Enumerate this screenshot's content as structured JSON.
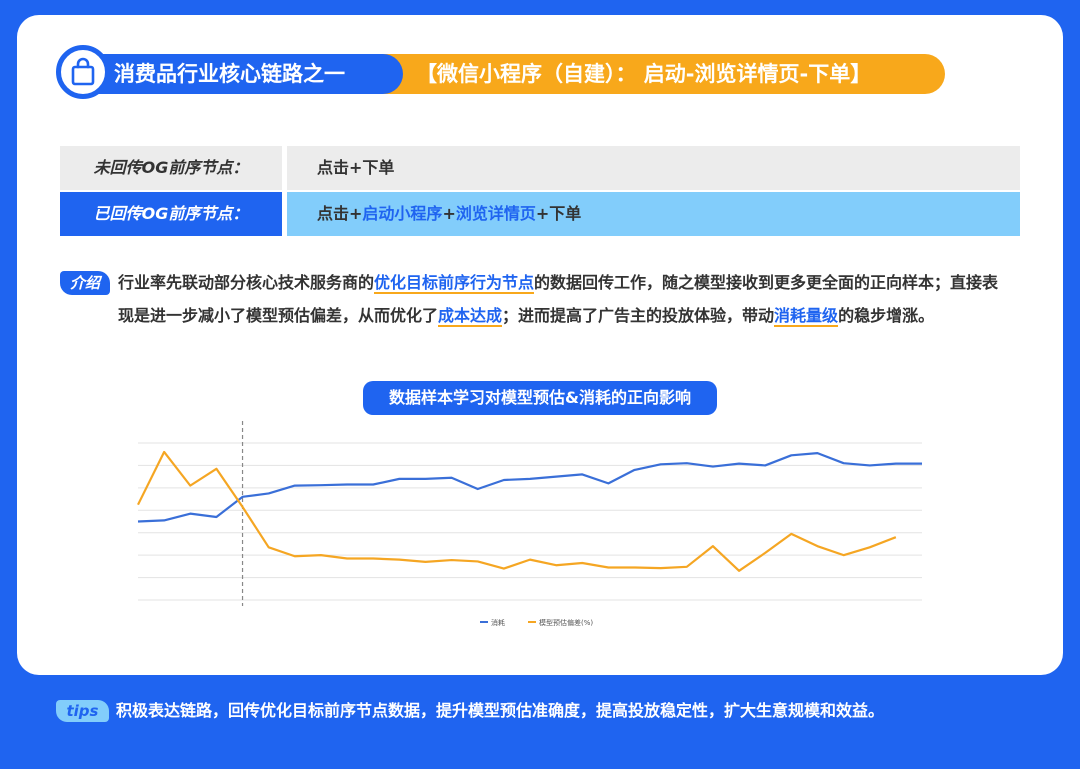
{
  "header": {
    "title": "消费品行业核心链路之一",
    "subtitle": "【微信小程序（自建）： 启动-浏览详情页-下单】",
    "icon": "shopping-bag-icon"
  },
  "table": {
    "row1": {
      "label": "未回传OG前序节点：",
      "value": "点击+下单"
    },
    "row2": {
      "label": "已回传OG前序节点：",
      "segments": [
        "点击+",
        "启动小程序",
        "+",
        "浏览详情页",
        "+下单"
      ]
    }
  },
  "intro": {
    "badge": "介绍",
    "p1": "行业率先联动部分核心技术服务商的",
    "k1": "优化目标前序行为节点",
    "p2": "的数据回传工作，随之模型接收到更多更全面的正向样本；直接表现是进一步减小了模型预估偏差，从而优化了",
    "k2": "成本达成",
    "p3": "；进而提高了广告主的投放体验，带动",
    "k3": "消耗量级",
    "p4": "的稳步增涨。"
  },
  "tips": {
    "badge": "tips",
    "text": "积极表达链路，回传优化目标前序节点数据，提升模型预估准确度，提高投放稳定性，扩大生意规模和效益。"
  },
  "colors": {
    "blue": "#1f64f0",
    "orange": "#f8a81b",
    "light_blue": "#82cdfb"
  },
  "chart_data": {
    "type": "line",
    "title": "数据样本学习对模型预估&消耗的正向影响",
    "x": [
      1,
      2,
      3,
      4,
      5,
      6,
      7,
      8,
      9,
      10,
      11,
      12,
      13,
      14,
      15,
      16,
      17,
      18,
      19,
      20,
      21,
      22,
      23,
      24,
      25,
      26,
      27,
      28,
      29,
      30,
      31
    ],
    "ylim": [
      0,
      7
    ],
    "grid": true,
    "legend_position": "bottom-center",
    "event_marker_x": 5,
    "series": [
      {
        "name": "消耗",
        "color": "#3a6fd8",
        "values": [
          3.5,
          3.55,
          3.85,
          3.7,
          4.6,
          4.75,
          5.1,
          5.12,
          5.15,
          5.15,
          5.4,
          5.4,
          5.45,
          4.95,
          5.35,
          5.4,
          5.5,
          5.6,
          5.2,
          5.8,
          6.05,
          6.1,
          5.95,
          6.08,
          6.0,
          6.45,
          6.55,
          6.1,
          6.0,
          6.08,
          6.08
        ]
      },
      {
        "name": "模型预估偏差(%)",
        "color": "#f5a623",
        "values": [
          4.25,
          6.6,
          5.1,
          5.85,
          4.15,
          2.35,
          1.95,
          2.0,
          1.85,
          1.85,
          1.8,
          1.7,
          1.78,
          1.72,
          1.4,
          1.8,
          1.55,
          1.65,
          1.45,
          1.45,
          1.42,
          1.48,
          2.4,
          1.3,
          2.1,
          2.95,
          2.4,
          2.0,
          2.35,
          2.8
        ]
      }
    ]
  }
}
